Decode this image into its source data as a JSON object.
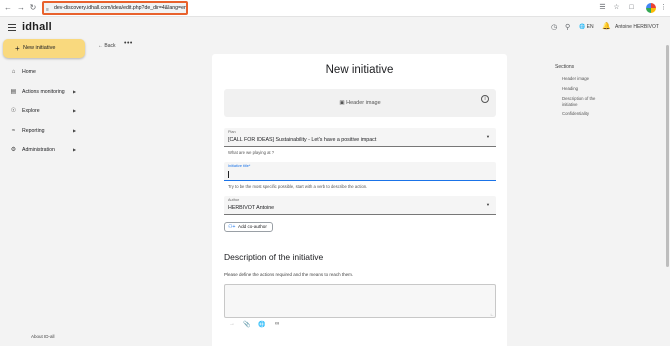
{
  "browser": {
    "url": "dev-discovery.idhall.com/idea/edit.php?de_dir=4&lang=en"
  },
  "app": {
    "logo": "idhall",
    "language": "EN",
    "user_name": "Antoine HERBIVOT"
  },
  "sidebar": {
    "new_button": "New initiative",
    "items": [
      {
        "label": "Home"
      },
      {
        "label": "Actions monitoring"
      },
      {
        "label": "Explore"
      },
      {
        "label": "Reporting"
      },
      {
        "label": "Administration"
      }
    ],
    "about": "About ID-all"
  },
  "toolbar": {
    "back_label": "Back",
    "more_label": "•••"
  },
  "form": {
    "title": "New initiative",
    "header_image_label": "Header image",
    "plan": {
      "label": "Plan",
      "value": "[CALL FOR IDEAS] Sustainability - Let's have a positive impact",
      "help": "What are we playing at ?"
    },
    "initiative_title": {
      "label": "Initiative title*",
      "value": "",
      "help": "Try to be the most specific possible, start with a verb to describe the action."
    },
    "author": {
      "label": "Author",
      "value": "HERBIVOT Antoine"
    },
    "add_coauthor": "Add co-author",
    "description": {
      "title": "Description of the initiative",
      "help": "Please define the actions required and the means to reach them."
    }
  },
  "sections": {
    "heading": "Sections",
    "links": [
      "Header image",
      "Heading",
      "Description of the initiative",
      "Confidentiality"
    ]
  },
  "colors": {
    "new_button_bg": "#f9d97e",
    "logo_accent": "#e88a3a",
    "focus_blue": "#1a73e8",
    "url_highlight": "#e8622d"
  }
}
